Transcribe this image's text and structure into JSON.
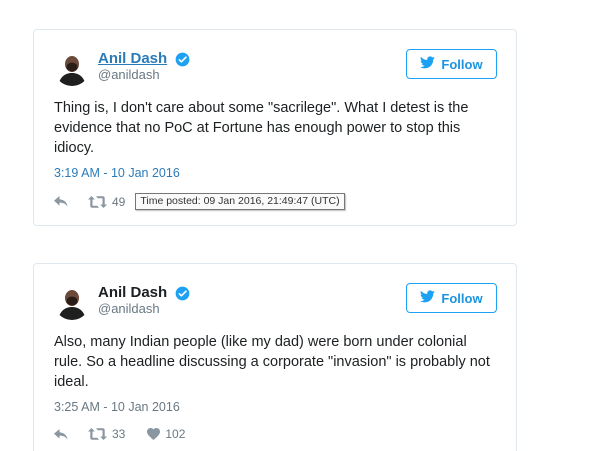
{
  "colors": {
    "link_blue": "#2b7bb9",
    "follow_blue": "#1da1f2",
    "text": "#1c2022",
    "muted": "#697882",
    "border": "#e1e8ed"
  },
  "tweets": [
    {
      "author": {
        "name": "Anil Dash",
        "handle": "@anildash",
        "verified": true
      },
      "follow_label": "Follow",
      "text": "Thing is, I don't care about some \"sacrilege\". What I detest is the evidence that no PoC at Fortune has enough power to stop this idiocy.",
      "timestamp": "3:19 AM - 10 Jan 2016",
      "retweets": "49",
      "tooltip": "Time posted: 09 Jan 2016, 21:49:47 (UTC)"
    },
    {
      "author": {
        "name": "Anil Dash",
        "handle": "@anildash",
        "verified": true
      },
      "follow_label": "Follow",
      "text": "Also, many Indian people (like my dad) were born under colonial rule. So a headline discussing a corporate \"invasion\" is probably not ideal.",
      "timestamp": "3:25 AM - 10 Jan 2016",
      "retweets": "33",
      "likes": "102"
    }
  ],
  "icons": [
    "avatar",
    "verified-icon",
    "twitter-bird-icon",
    "reply-icon",
    "retweet-icon",
    "heart-icon"
  ]
}
